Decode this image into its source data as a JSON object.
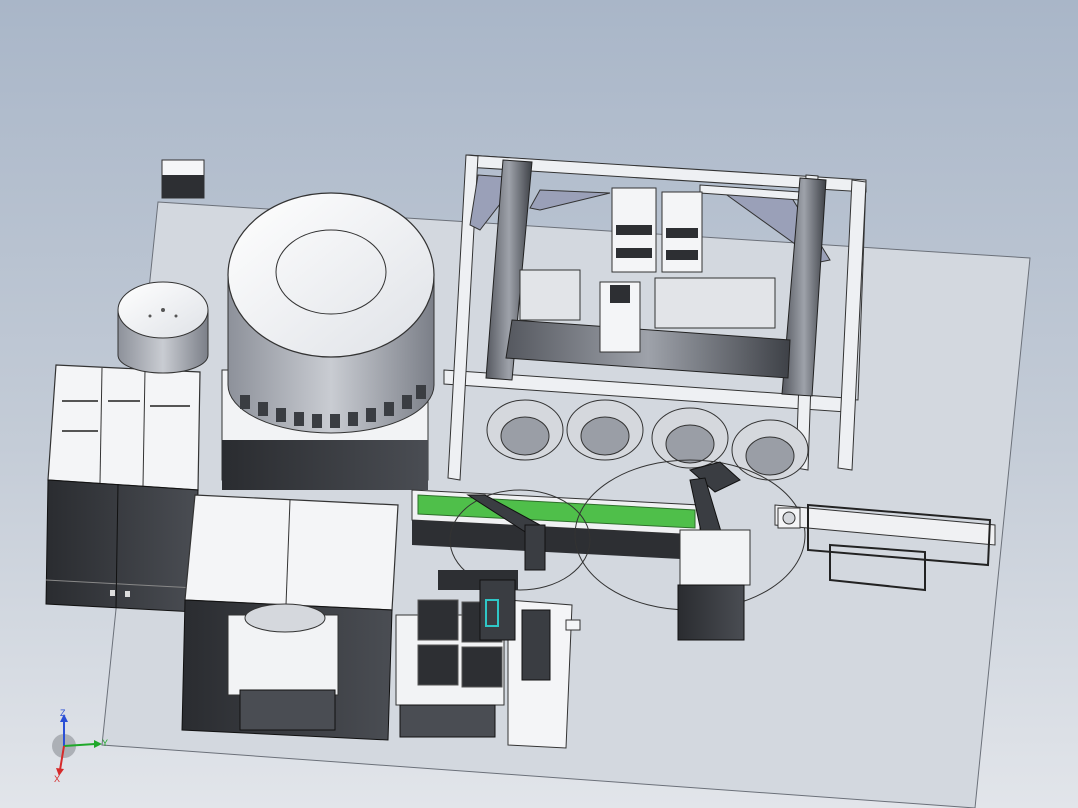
{
  "viewport": {
    "background_top": "#a9b6c8",
    "background_bottom": "#e2e5ea"
  },
  "model": {
    "description_visible": false,
    "machine_colors": {
      "panel": "#f2f3f5",
      "frame": "#e8eaee",
      "dark": "#2d2f33",
      "accent_green": "#4fbf4a"
    }
  },
  "triad": {
    "z_label": "Z",
    "y_label": "Y",
    "x_label": "X",
    "z_color": "#2a4fd6",
    "y_color": "#1fa82a",
    "x_color": "#d62a2a"
  }
}
